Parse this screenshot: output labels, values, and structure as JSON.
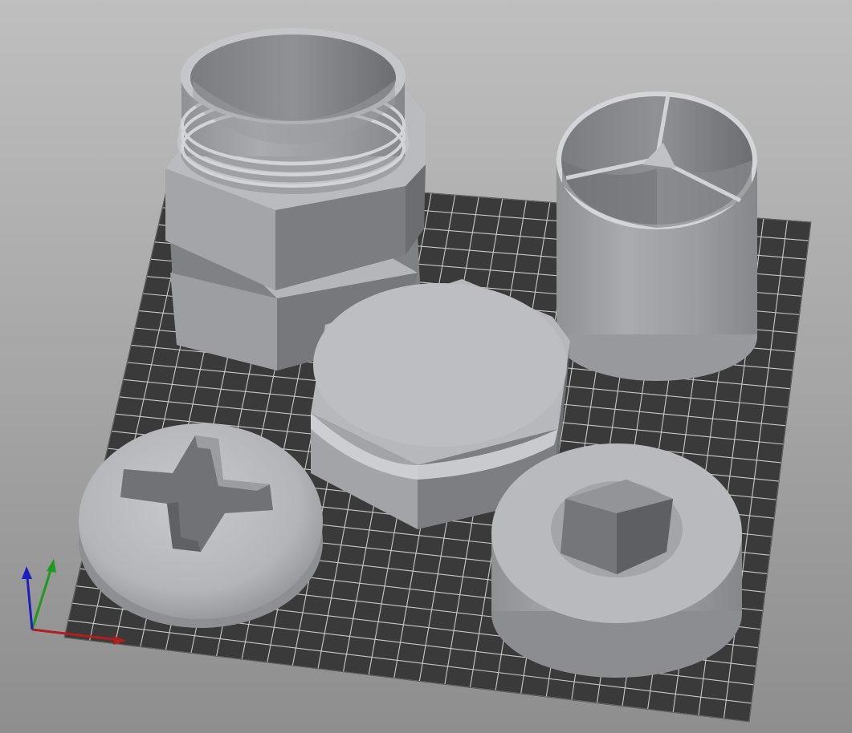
{
  "viewport": {
    "type": "3d-slicer-print-bed-view",
    "background_top": "#bfbfbf",
    "background_bottom": "#8e8e8e",
    "bed_color": "#3a3a3a",
    "grid_color": "#c8c8c8",
    "model_color": "#a6a8ab"
  },
  "objects": [
    {
      "id": "threaded-hex-nut",
      "shape": "hex nut with threaded cylinder neck"
    },
    {
      "id": "divided-cylinder-cup",
      "shape": "open cylinder with three inner dividers"
    },
    {
      "id": "hex-bolt-head",
      "shape": "domed hexagonal bolt head"
    },
    {
      "id": "phillips-screw-head",
      "shape": "domed head with cross recess"
    },
    {
      "id": "hex-socket-washer",
      "shape": "round washer with hexagonal socket"
    }
  ],
  "axes": [
    {
      "name": "x",
      "color": "#b01e1e"
    },
    {
      "name": "y",
      "color": "#1e9a1e"
    },
    {
      "name": "z",
      "color": "#1e1ebe"
    }
  ]
}
